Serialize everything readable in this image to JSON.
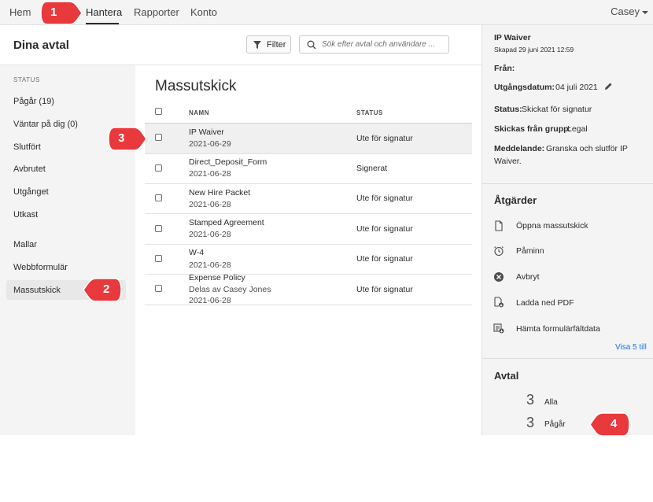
{
  "nav": {
    "items": [
      "Hem",
      "Hantera",
      "Rapporter",
      "Konto"
    ],
    "user": "Casey"
  },
  "sidebar": {
    "title": "Dina avtal",
    "status_heading": "STATUS",
    "items": [
      "Pågår (19)",
      "Väntar på dig (0)",
      "Slutfört",
      "Avbrutet",
      "Utgånget",
      "Utkast",
      "Mallar",
      "Webbformulär",
      "Massutskick"
    ]
  },
  "toolbar": {
    "filter_label": "Filter",
    "search_placeholder": "Sök efter avtal och användare ..."
  },
  "main": {
    "title": "Massutskick",
    "columns": [
      "NAMN",
      "STATUS"
    ],
    "rows": [
      {
        "name": "IP Waiver",
        "sub": "",
        "date": "2021-06-29",
        "status": "Ute för signatur"
      },
      {
        "name": "Direct_Deposit_Form",
        "sub": "",
        "date": "2021-06-28",
        "status": "Signerat"
      },
      {
        "name": "New Hire Packet",
        "sub": "",
        "date": "2021-06-28",
        "status": "Ute för signatur"
      },
      {
        "name": "Stamped Agreement",
        "sub": "",
        "date": "2021-06-28",
        "status": "Ute för signatur"
      },
      {
        "name": "W-4",
        "sub": "",
        "date": "2021-06-28",
        "status": "Ute för signatur"
      },
      {
        "name": "Expense Policy",
        "sub": "Delas av Casey Jones",
        "date": "2021-06-28",
        "status": "Ute för signatur"
      }
    ]
  },
  "panel": {
    "title": "IP Waiver",
    "created": "Skapad 29 juni 2021 12:59",
    "from_label": "Från:",
    "expiry_label": "Utgångsdatum:",
    "expiry_value": "04 juli 2021",
    "status_label": "Status:",
    "status_value": "Skickat för signatur",
    "group_label": "Skickas från grupp:",
    "group_value": "Legal",
    "message_label": "Meddelande:",
    "message_line1": "Granska och slutför IP",
    "message_line2": "Waiver.",
    "actions_title": "Åtgärder",
    "actions": [
      "Öppna massutskick",
      "Påminn",
      "Avbryt",
      "Ladda ned PDF",
      "Hämta formulärfältdata"
    ],
    "show_more": "Visa 5 till",
    "agreements_title": "Avtal",
    "counts": [
      {
        "num": "3",
        "label": "Alla"
      },
      {
        "num": "3",
        "label": "Pågår"
      }
    ]
  },
  "callouts": [
    "1",
    "2",
    "3",
    "4"
  ],
  "colors": {
    "callout": "#e8393d",
    "link": "#1473e6"
  }
}
